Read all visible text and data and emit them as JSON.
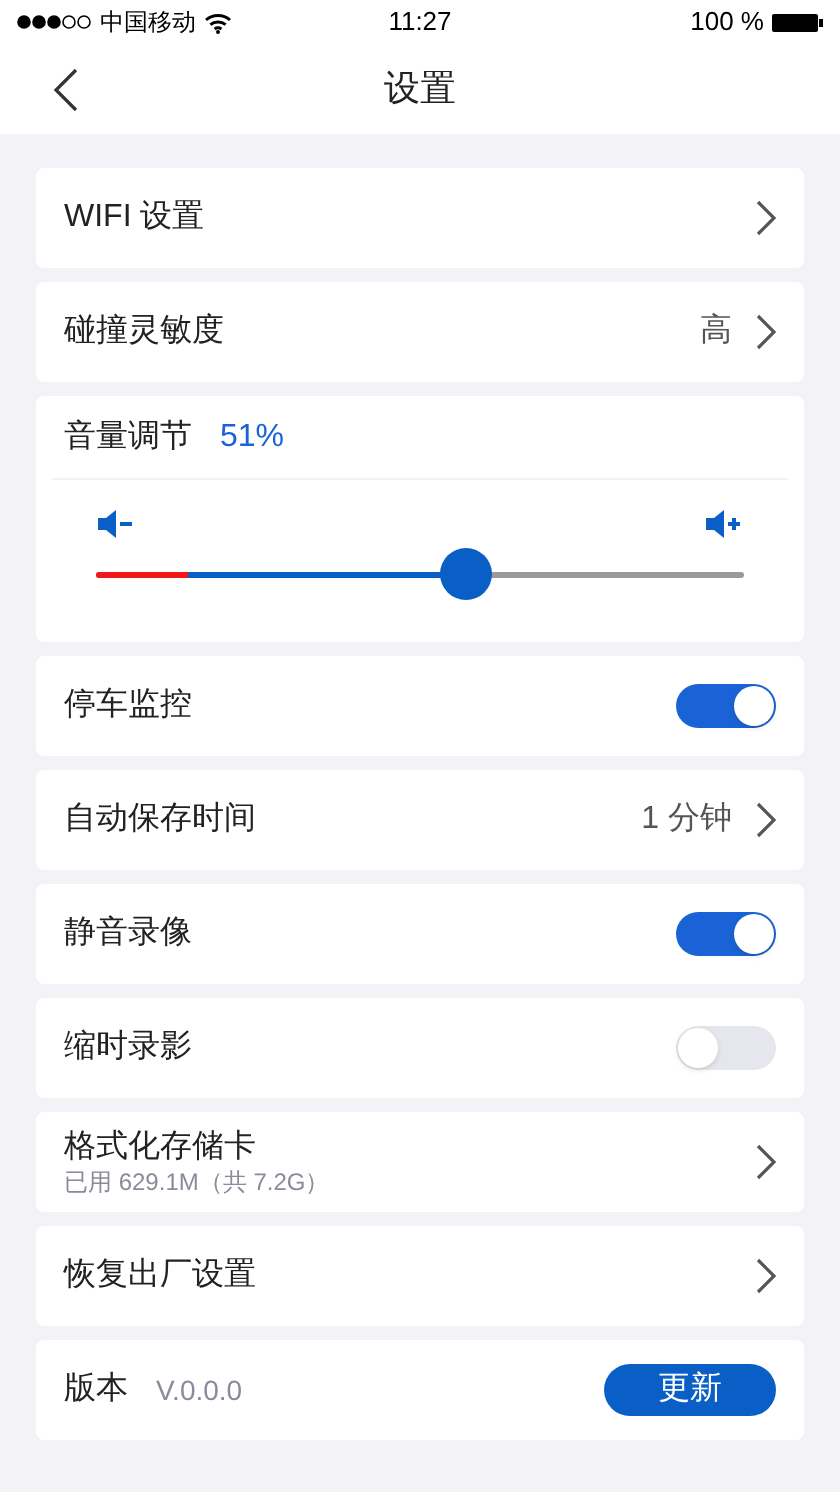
{
  "status_bar": {
    "carrier": "中国移动",
    "time": "11:27",
    "battery": "100 %"
  },
  "nav": {
    "title": "设置"
  },
  "rows": [
    {
      "kind": "link",
      "label": "WIFI 设置"
    },
    {
      "kind": "link",
      "label": "碰撞灵敏度",
      "value": "高"
    },
    {
      "kind": "slider",
      "label": "音量调节",
      "reading": "51%",
      "level": 0.57
    },
    {
      "kind": "toggle",
      "label": "停车监控",
      "on": true
    },
    {
      "kind": "link",
      "label": "自动保存时间",
      "value": "1 分钟"
    },
    {
      "kind": "toggle",
      "label": "静音录像",
      "on": true
    },
    {
      "kind": "toggle",
      "label": "缩时录影",
      "on": false
    },
    {
      "kind": "link",
      "label": "格式化存储卡",
      "subtitle": "已用 629.1M（共 7.2G）"
    },
    {
      "kind": "link",
      "label": "恢复出厂设置"
    },
    {
      "kind": "version",
      "label": "版本",
      "value": "V.0.0.0",
      "button": "更新"
    }
  ]
}
